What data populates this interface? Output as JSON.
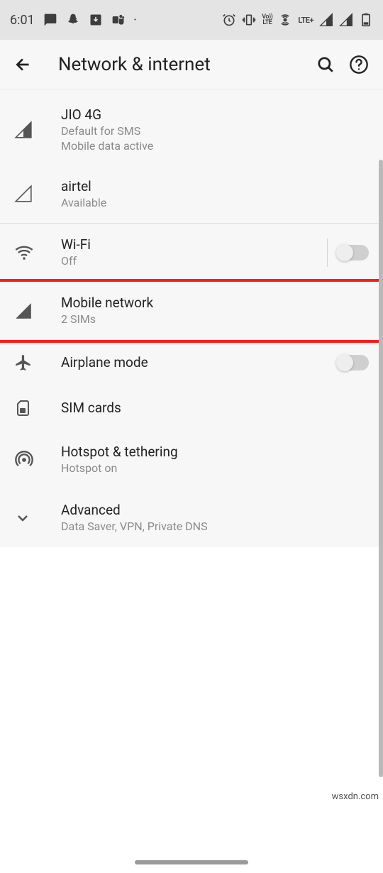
{
  "statusbar": {
    "time": "6:01",
    "lte_label": "LTE+",
    "volte_label": "Vo))\nLTE"
  },
  "header": {
    "title": "Network & internet"
  },
  "sim1": {
    "name": "JIO 4G",
    "line1": "Default for SMS",
    "line2": "Mobile data active"
  },
  "sim2": {
    "name": "airtel",
    "line1": "Available"
  },
  "wifi": {
    "label": "Wi-Fi",
    "sub": "Off"
  },
  "mobile": {
    "label": "Mobile network",
    "sub": "2 SIMs"
  },
  "airplane": {
    "label": "Airplane mode"
  },
  "simcards": {
    "label": "SIM cards"
  },
  "hotspot": {
    "label": "Hotspot & tethering",
    "sub": "Hotspot on"
  },
  "advanced": {
    "label": "Advanced",
    "sub": "Data Saver, VPN, Private DNS"
  },
  "watermark": "wsxdn.com"
}
